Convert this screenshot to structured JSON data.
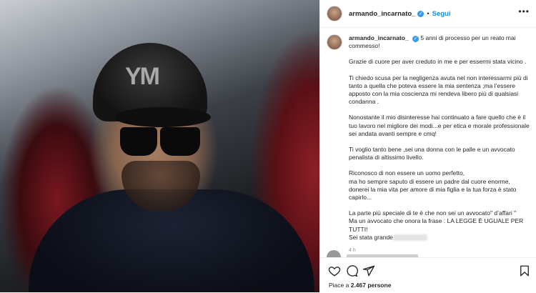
{
  "post": {
    "username": "armando_incarnato_",
    "follow_label": "Segui",
    "more_label": "•••",
    "verified_glyph": "✓",
    "header_separator": "•"
  },
  "caption": {
    "username": "armando_incarnato_",
    "verified_glyph": "✓",
    "paragraphs": [
      "5 anni di processo per un reato mai commesso!",
      "Grazie di cuore per aver creduto in me e per essermi stata vicino .",
      "Ti chiedo scusa per la negligenza avuta nel non interessarmi più di tanto a quella che poteva essere la mia sentenza ;ma l’essere apposto con la mia coscienza mi rendeva libero più di qualsiasi condanna .",
      "Nonostante il mio disinteresse hai continuato a fare quello che è il tuo lavoro nel migliore dei modi...e per etica e morale professionale sei andata avanti sempre e cmq!",
      "Ti voglio tanto bene ,sei una donna con le palle e un avvocato penalista di altissimo livello.",
      "Riconosco di non essere un uomo perfetto,\nma ho sempre saputo di essere un padre dal cuore enorme, donerei la mia vita per amore di mia figlia e la tua forza è stato capirlo...",
      "La parte più speciale di te è che non sei un avvocato\" d’affari \"\nMa un avvocato che onora la frase : LA LEGGE È UGUALE PER TUTTI!",
      "Sei stata grande"
    ],
    "time_ago": "4 h"
  },
  "actions": {
    "like_icon": "heart-icon",
    "comment_icon": "comment-icon",
    "share_icon": "share-icon",
    "save_icon": "bookmark-icon",
    "likes_prefix": "Piace a ",
    "likes_count": "2.467 persone"
  },
  "colors": {
    "accent": "#0095f6",
    "verified": "#3897f0"
  }
}
